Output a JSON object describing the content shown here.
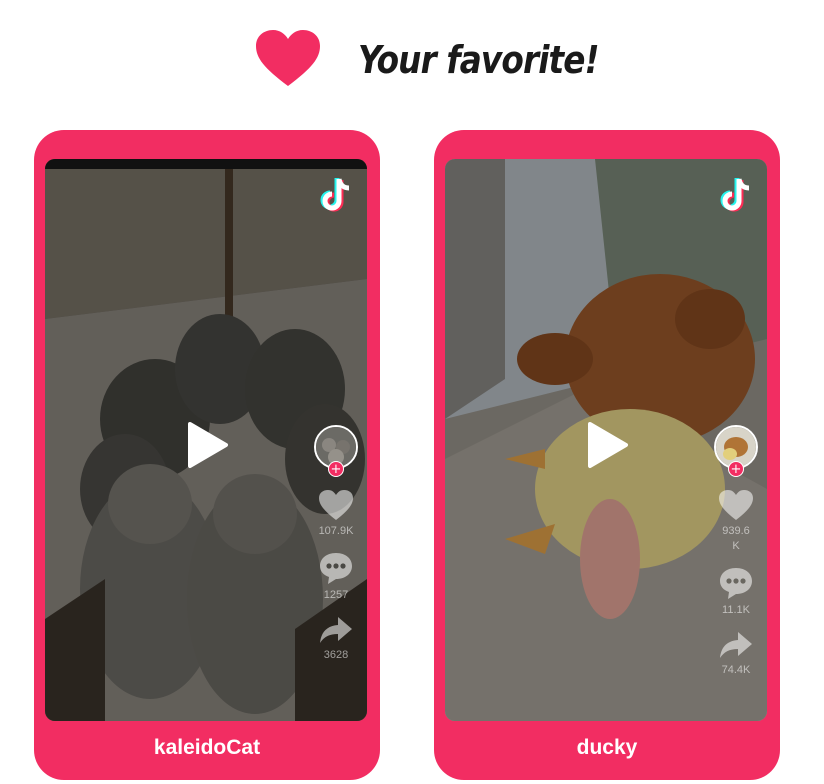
{
  "header": {
    "title": "Your favorite!",
    "heart_icon": "heart-icon",
    "accent_color": "#f22d62"
  },
  "cards": [
    {
      "label": "kaleidoCat",
      "likes": "107.9K",
      "comments": "1257",
      "shares": "3628",
      "icons": [
        "tiktok-icon",
        "play-icon",
        "avatar",
        "heart-icon",
        "comment-icon",
        "share-icon"
      ]
    },
    {
      "label": "ducky",
      "likes": "939.6\nK",
      "comments": "11.1K",
      "shares": "74.4K",
      "icons": [
        "tiktok-icon",
        "play-icon",
        "avatar",
        "heart-icon",
        "comment-icon",
        "share-icon"
      ]
    }
  ]
}
